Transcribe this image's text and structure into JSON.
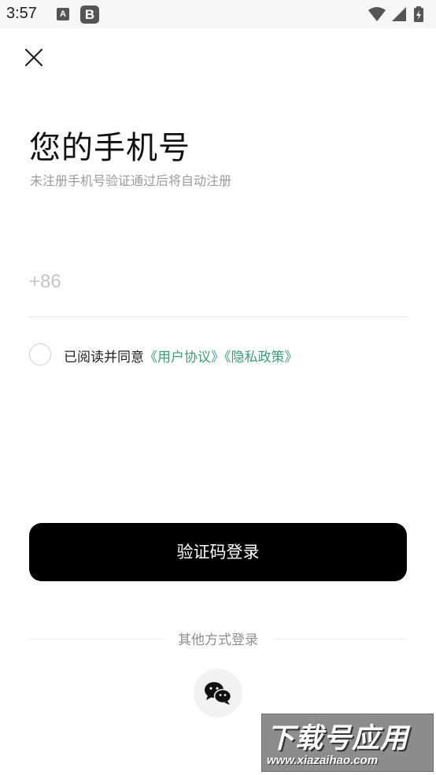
{
  "status_bar": {
    "time": "3:57",
    "notif_a": "A",
    "notif_b": "B",
    "icons": [
      "wifi-icon",
      "signal-icon",
      "battery-charging-icon"
    ]
  },
  "header": {
    "close_icon": "close-icon"
  },
  "main": {
    "title": "您的手机号",
    "subtitle": "未注册手机号验证通过后将自动注册",
    "phone_placeholder": "+86",
    "phone_value": ""
  },
  "agreement": {
    "checked": false,
    "prefix": "已阅读并同意",
    "user_agreement": "《用户协议》",
    "privacy_policy": "《隐私政策》"
  },
  "actions": {
    "login_label": "验证码登录",
    "other_methods": "其他方式登录",
    "wechat_icon": "wechat-icon"
  },
  "watermark": {
    "title": "下载号应用",
    "url": "www.xiazaihao.com"
  },
  "colors": {
    "link": "#3d9b7a",
    "button_bg": "#000000",
    "button_text": "#ffffff",
    "subtitle": "#9a9a9a"
  }
}
